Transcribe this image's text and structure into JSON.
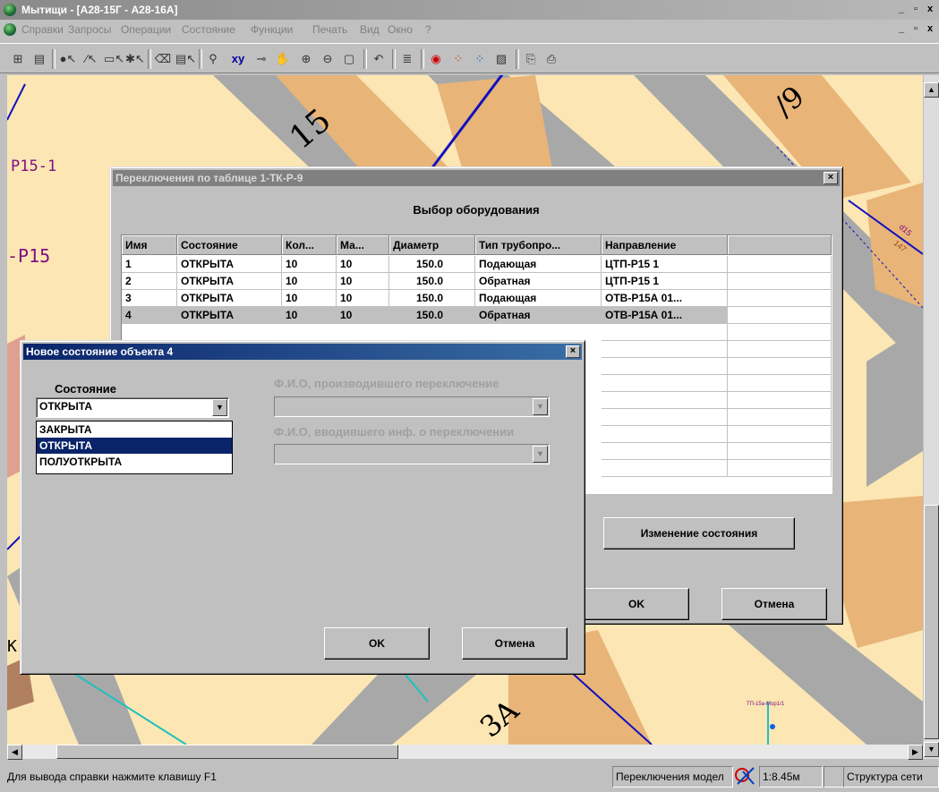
{
  "window": {
    "title": "Мытищи - [A28-15Г - A28-16A]",
    "min": "_",
    "max": "▫",
    "close": "x"
  },
  "menu": [
    "Справки",
    "Запросы",
    "Операции",
    "Состояние",
    "Функции",
    "Печать",
    "Вид",
    "Окно",
    "?"
  ],
  "map": {
    "labels": [
      "15",
      "P15-1",
      "-P15",
      "3A",
      "/9",
      "d15",
      "147",
      "ТП-15а-Мор1/1",
      "K-"
    ]
  },
  "switch_dialog": {
    "title": "Переключения по таблице 1-ТК-Р-9",
    "heading": "Выбор оборудования",
    "columns": [
      "Имя",
      "Состояние",
      "Кол...",
      "Ма...",
      "Диаметр",
      "Тип трубопро...",
      "Направление"
    ],
    "rows": [
      [
        "1",
        "ОТКРЫТА",
        "10",
        "10",
        "150.0",
        "Подающая",
        "ЦТП-Р15 1"
      ],
      [
        "2",
        "ОТКРЫТА",
        "10",
        "10",
        "150.0",
        "Обратная",
        "ЦТП-Р15 1"
      ],
      [
        "3",
        "ОТКРЫТА",
        "10",
        "10",
        "150.0",
        "Подающая",
        "ОТВ-Р15А  01..."
      ],
      [
        "4",
        "ОТКРЫТА",
        "10",
        "10",
        "150.0",
        "Обратная",
        "ОТВ-Р15А  01..."
      ]
    ],
    "change_state_button": "Изменение состояния",
    "ok_button": "OK",
    "cancel_button": "Отмена"
  },
  "state_dialog": {
    "title": "Новое состояние объекта 4",
    "state_label": "Состояние",
    "state_value": "ОТКРЫТА",
    "state_options": [
      "ЗАКРЫТА",
      "ОТКРЫТА",
      "ПОЛУОТКРЫТА"
    ],
    "selected_option": "ОТКРЫТА",
    "switcher_label": "Ф.И.О, производившего переключение",
    "entered_label": "Ф.И.О, вводившего инф. о переключении",
    "ok_button": "OK",
    "cancel_button": "Отмена"
  },
  "status": {
    "hint": "Для вывода справки нажмите клавишу F1",
    "mode": "Переключения модел",
    "scale": "1:8.45м",
    "layer": "Структура сети"
  },
  "colors": {
    "title_active": "#0a246a",
    "title_inactive": "#808080",
    "map_bg": "#fbe6b4",
    "building": "#e8b478",
    "road": "#a0a0a0",
    "pipe_blue": "#1010c0",
    "pipe_cyan": "#20c0c0"
  }
}
